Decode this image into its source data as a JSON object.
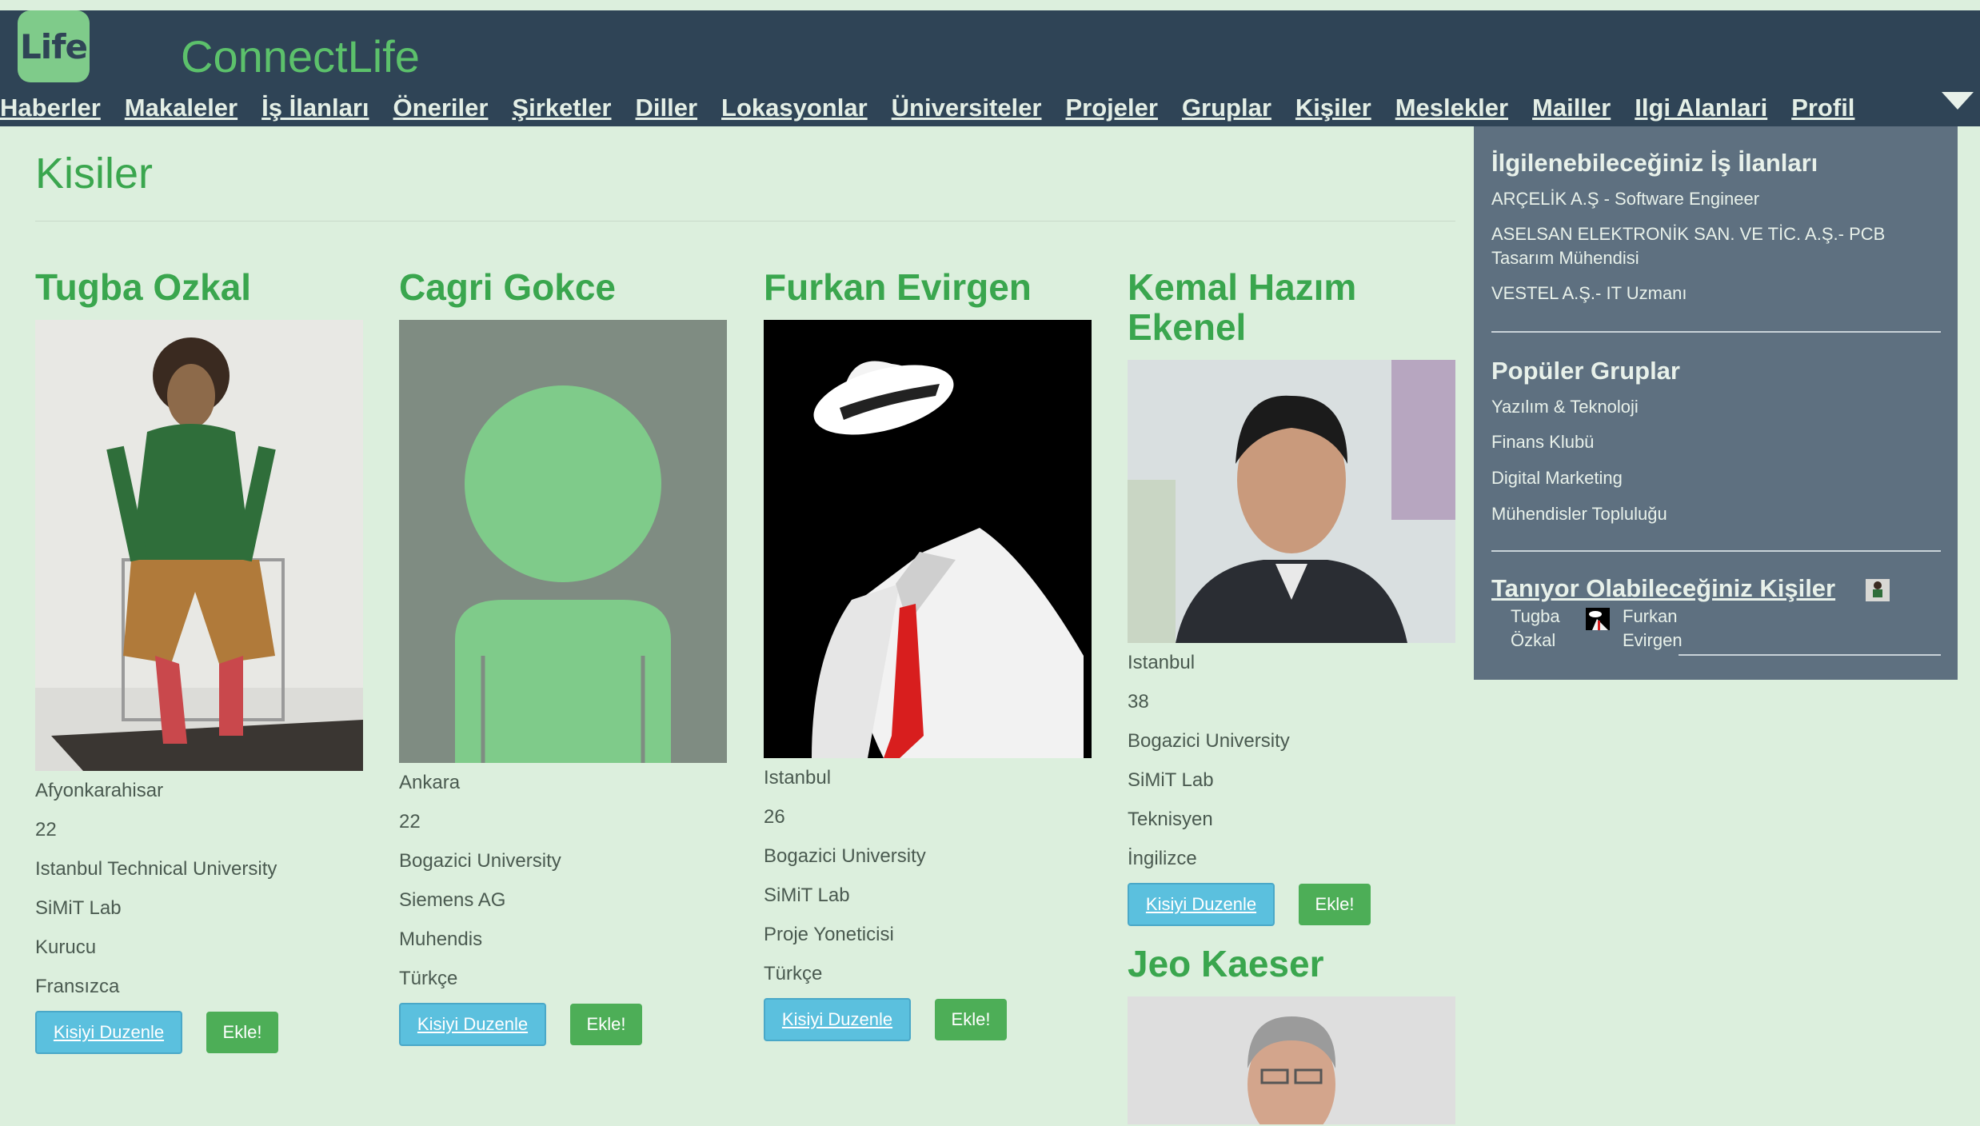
{
  "app": {
    "logo_text": "Life",
    "brand": "ConnectLife"
  },
  "nav": {
    "items": [
      "Haberler",
      "Makaleler",
      "İş İlanları",
      "Öneriler",
      "Şirketler",
      "Diller",
      "Lokasyonlar",
      "Üniversiteler",
      "Projeler",
      "Gruplar",
      "Kişiler",
      "Meslekler",
      "Mailler",
      "Ilgi Alanlari",
      "Profil"
    ]
  },
  "page": {
    "title": "Kisiler"
  },
  "people": [
    {
      "name": "Tugba Ozkal",
      "info": [
        "Afyonkarahisar",
        "22",
        "Istanbul Technical University",
        "SiMiT Lab",
        "Kurucu",
        "Fransızca"
      ],
      "edit_label": "Kisiyi Duzenle",
      "add_label": "Ekle!"
    },
    {
      "name": "Cagri Gokce",
      "info": [
        "Ankara",
        "22",
        "Bogazici University",
        "Siemens AG",
        "Muhendis",
        "Türkçe"
      ],
      "edit_label": "Kisiyi Duzenle",
      "add_label": "Ekle!"
    },
    {
      "name": "Furkan Evirgen",
      "info": [
        "Istanbul",
        "26",
        "Bogazici University",
        "SiMiT Lab",
        "Proje Yoneticisi",
        "Türkçe"
      ],
      "edit_label": "Kisiyi Duzenle",
      "add_label": "Ekle!"
    },
    {
      "name": "Kemal Hazım Ekenel",
      "info": [
        "Istanbul",
        "38",
        "Bogazici University",
        "SiMiT Lab",
        "Teknisyen",
        "İngilizce"
      ],
      "edit_label": "Kisiyi Duzenle",
      "add_label": "Ekle!"
    },
    {
      "name": "Jeo Kaeser",
      "info": []
    }
  ],
  "sidebar": {
    "jobs_heading": "İlgilenebileceğiniz İş İlanları",
    "jobs": [
      "ARÇELİK A.Ş - Software Engineer",
      "ASELSAN ELEKTRONİK SAN. VE TİC. A.Ş.- PCB Tasarım Mühendisi",
      "VESTEL A.Ş.- IT Uzmanı"
    ],
    "groups_heading": "Popüler Gruplar",
    "groups": [
      "Yazılım & Teknoloji",
      "Finans Klubü",
      "Digital Marketing",
      "Mühendisler Topluluğu"
    ],
    "people_heading": "Tanıyor Olabileceğiniz Kişiler",
    "people": [
      {
        "first": "Tugba",
        "last": "Özkal"
      },
      {
        "first": "Furkan",
        "last": "Evirgen"
      }
    ]
  },
  "colors": {
    "background": "#dcefdd",
    "navbar": "#2f4456",
    "brand_green": "#5cc16b",
    "title_green": "#3aa64e",
    "panel": "#5e7080",
    "edit_button": "#5bc0de",
    "add_button": "#4dae57"
  }
}
